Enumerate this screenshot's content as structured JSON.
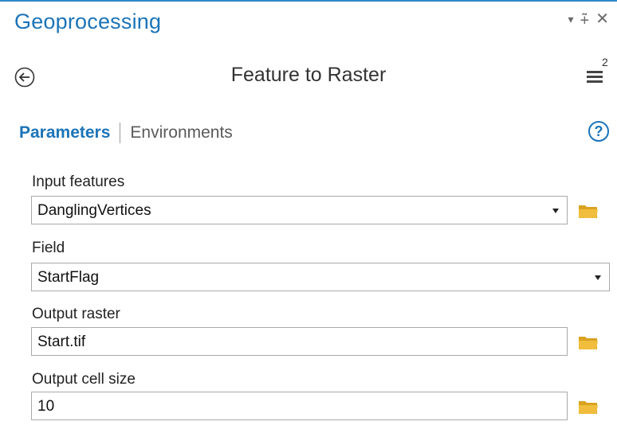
{
  "pane": {
    "title": "Geoprocessing",
    "controls": {
      "dropdown_icon": "▾",
      "pin_icon": "⨤",
      "close_icon": "✕"
    }
  },
  "tool": {
    "title": "Feature to Raster",
    "menu_badge": "2"
  },
  "tabs": {
    "parameters": "Parameters",
    "environments": "Environments",
    "help_icon": "?"
  },
  "params": [
    {
      "label": "Input features",
      "value": "DanglingVertices",
      "type": "dropdown",
      "browse": true
    },
    {
      "label": "Field",
      "value": "StartFlag",
      "type": "dropdown",
      "browse": false
    },
    {
      "label": "Output raster",
      "value": "Start.tif",
      "type": "text",
      "browse": true
    },
    {
      "label": "Output cell size",
      "value": "10",
      "type": "text",
      "browse": true
    }
  ],
  "colors": {
    "accent": "#1b74b8",
    "folder": "#e8b32a"
  }
}
